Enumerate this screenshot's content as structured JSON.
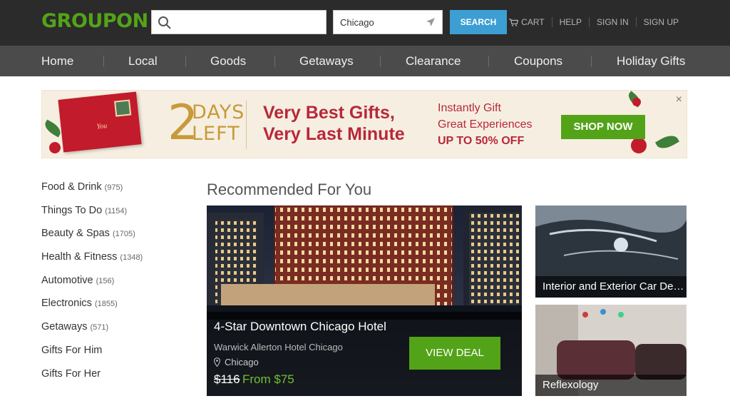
{
  "header": {
    "logo": "GROUPON",
    "search": {
      "value": "",
      "placeholder": ""
    },
    "location": {
      "value": "Chicago"
    },
    "search_button": "SEARCH",
    "links": {
      "cart": "CART",
      "help": "HELP",
      "sign_in": "SIGN IN",
      "sign_up": "SIGN UP"
    }
  },
  "nav": {
    "items": [
      "Home",
      "Local",
      "Goods",
      "Getaways",
      "Clearance",
      "Coupons",
      "Holiday Gifts"
    ]
  },
  "banner": {
    "envelope_text": "You",
    "days_number": "2",
    "days_word": "DAYS",
    "left_word": "LEFT",
    "headline_line1": "Very Best Gifts,",
    "headline_line2": "Very Last Minute",
    "sub_line1": "Instantly Gift",
    "sub_line2": "Great Experiences",
    "sub_line3": "UP TO 50% OFF",
    "cta": "SHOP NOW",
    "close": "×"
  },
  "sidebar": {
    "categories": [
      {
        "label": "Food & Drink",
        "count": "(975)"
      },
      {
        "label": "Things To Do",
        "count": "(1154)"
      },
      {
        "label": "Beauty & Spas",
        "count": "(1705)"
      },
      {
        "label": "Health & Fitness",
        "count": "(1348)"
      },
      {
        "label": "Automotive",
        "count": "(156)"
      },
      {
        "label": "Electronics",
        "count": "(1855)"
      },
      {
        "label": "Getaways",
        "count": "(571)"
      },
      {
        "label": "Gifts For Him",
        "count": ""
      },
      {
        "label": "Gifts For Her",
        "count": ""
      }
    ]
  },
  "recommended": {
    "title": "Recommended For You",
    "featured": {
      "title": "4-Star Downtown Chicago Hotel",
      "merchant": "Warwick Allerton Hotel Chicago",
      "location": "Chicago",
      "old_price": "$116",
      "new_price": "From $75",
      "cta": "VIEW DEAL"
    },
    "cards": [
      {
        "caption": "Interior and Exterior Car Detailing"
      },
      {
        "caption": "Reflexology"
      }
    ]
  },
  "colors": {
    "brand_green": "#53a318",
    "search_blue": "#3d9ed3",
    "topbar": "#2b2b2b",
    "navbar": "#4b4b4b",
    "banner_red": "#b8283a",
    "banner_gold": "#c89a3a"
  }
}
